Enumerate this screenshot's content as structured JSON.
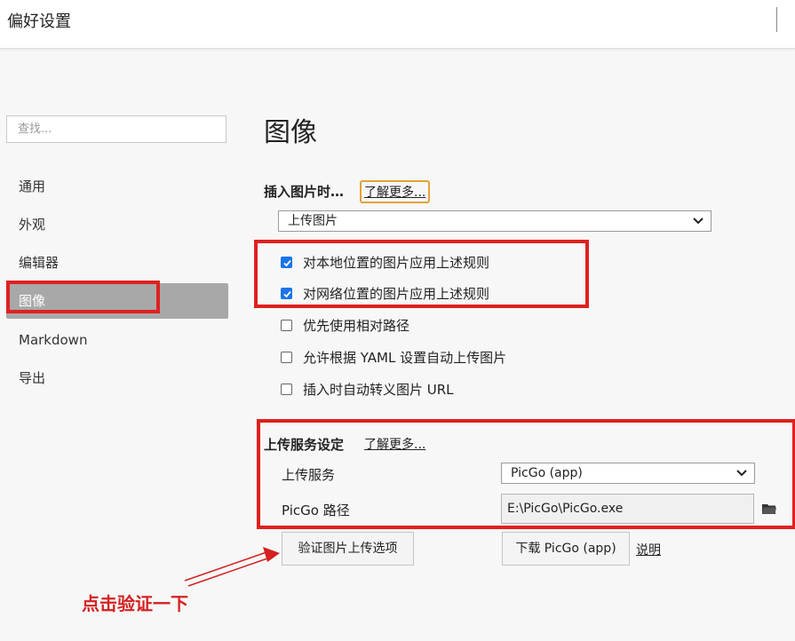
{
  "window": {
    "title": "偏好设置"
  },
  "sidebar": {
    "search_placeholder": "查找...",
    "items": [
      {
        "label": "通用"
      },
      {
        "label": "外观"
      },
      {
        "label": "编辑器"
      },
      {
        "label": "图像",
        "active": true
      },
      {
        "label": "Markdown"
      },
      {
        "label": "导出"
      }
    ]
  },
  "main": {
    "title": "图像",
    "insert": {
      "label": "插入图片时…",
      "learn_more": "了解更多...",
      "action_value": "上传图片",
      "options": [
        {
          "label": "对本地位置的图片应用上述规则",
          "checked": true
        },
        {
          "label": "对网络位置的图片应用上述规则",
          "checked": true
        },
        {
          "label": "优先使用相对路径",
          "checked": false
        },
        {
          "label": "允许根据 YAML 设置自动上传图片",
          "checked": false
        },
        {
          "label": "插入时自动转义图片 URL",
          "checked": false
        }
      ]
    },
    "upload": {
      "label": "上传服务设定",
      "learn_more": "了解更多...",
      "service_label": "上传服务",
      "service_value": "PicGo (app)",
      "path_label": "PicGo 路径",
      "path_value": "E:\\PicGo\\PicGo.exe",
      "verify_button": "验证图片上传选项",
      "download_button": "下载 PicGo (app)",
      "help_link": "说明"
    }
  },
  "annotation": {
    "text": "点击验证一下",
    "color": "#d42020"
  },
  "colors": {
    "active_nav": "#a8a8a8",
    "checkbox": "#1a73e8",
    "highlight_box": "#e02020",
    "learn_more_border": "#e2a33a"
  }
}
